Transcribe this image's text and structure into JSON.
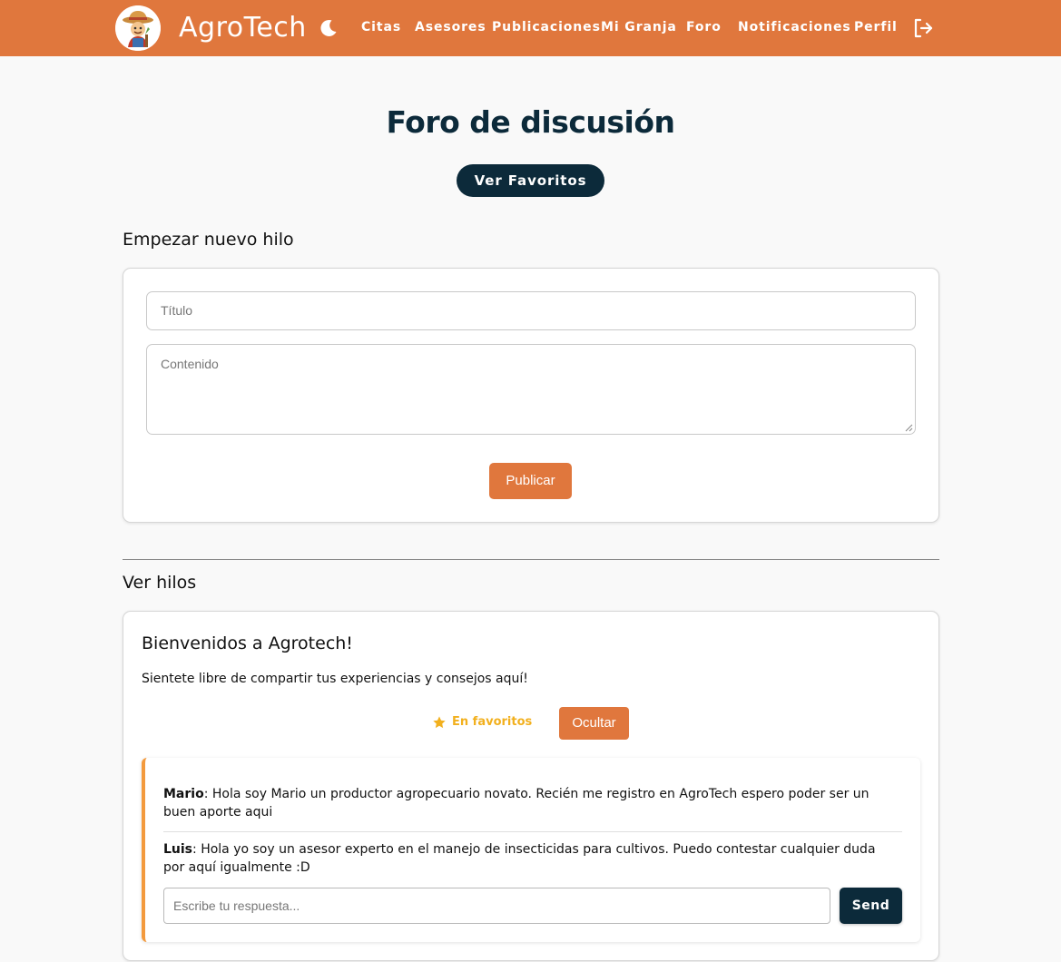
{
  "navbar": {
    "brand": "AgroTech",
    "links": [
      "Citas",
      "Asesores",
      "Publicaciones",
      "Mi Granja",
      "Foro",
      "Notificaciones",
      "Perfil"
    ]
  },
  "page": {
    "title": "Foro de discusión",
    "favorites_button": "Ver Favoritos"
  },
  "new_thread": {
    "heading": "Empezar nuevo hilo",
    "title_placeholder": "Título",
    "content_placeholder": "Contenido",
    "submit_label": "Publicar"
  },
  "threads": {
    "heading": "Ver hilos",
    "items": [
      {
        "title": "Bienvenidos a Agrotech!",
        "body": "Sientete libre de compartir tus experiencias y consejos aquí!",
        "favorite_label": "En favoritos",
        "hide_label": "Ocultar",
        "replies": [
          {
            "author": "Mario",
            "text": ": Hola soy Mario un productor agropecuario novato. Recién me registro en AgroTech espero poder ser un buen aporte aqui"
          },
          {
            "author": "Luis",
            "text": ": Hola yo soy un asesor experto en el manejo de insecticidas para cultivos. Puedo contestar cualquier duda por aquí igualmente :D"
          }
        ],
        "reply_placeholder": "Escribe tu respuesta...",
        "send_label": "Send"
      }
    ]
  },
  "colors": {
    "primary_orange": "#e0773d",
    "dark_navy": "#0c2a3a",
    "favorite_gold": "#f2b01e",
    "reply_accent": "#f39a3d"
  },
  "icons": {
    "logo": "farmer-mascot-icon",
    "theme_toggle": "moon-icon",
    "logout": "logout-icon",
    "favorite": "star-icon"
  }
}
